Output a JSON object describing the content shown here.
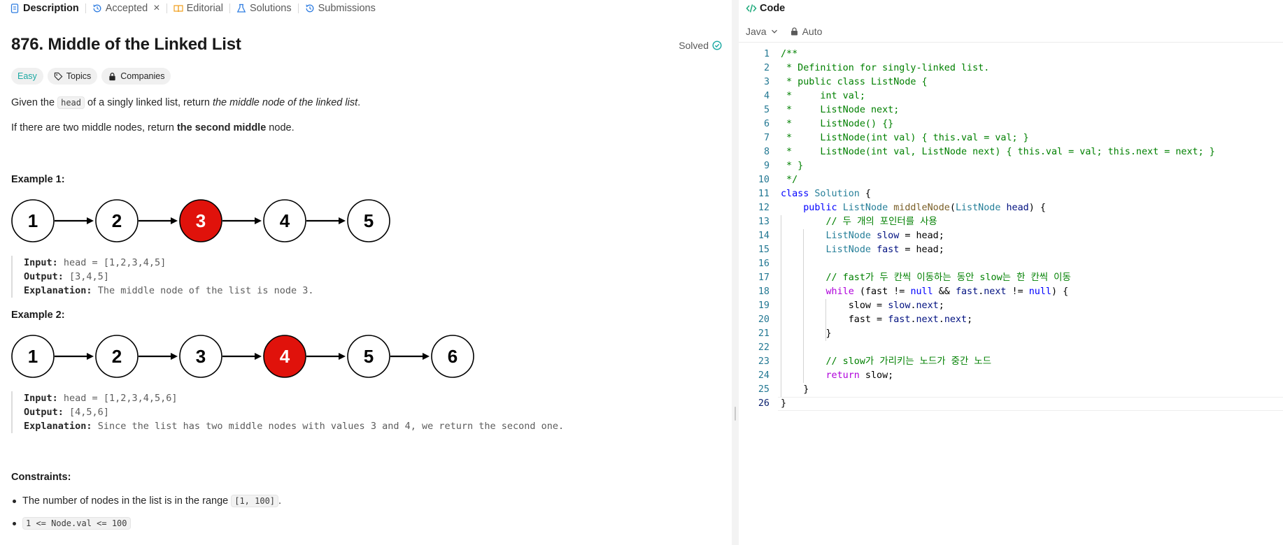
{
  "tabs": [
    {
      "label": "Description",
      "icon": "document-icon",
      "active": true
    },
    {
      "label": "Accepted",
      "icon": "history-icon",
      "active": false,
      "closable": true
    },
    {
      "label": "Editorial",
      "icon": "book-icon",
      "active": false
    },
    {
      "label": "Solutions",
      "icon": "flask-icon",
      "active": false
    },
    {
      "label": "Submissions",
      "icon": "history-icon",
      "active": false
    }
  ],
  "problem": {
    "title": "876. Middle of the Linked List",
    "status": "Solved",
    "tags": [
      {
        "label": "Easy",
        "kind": "difficulty",
        "color": "#1ca9a3"
      },
      {
        "label": "Topics",
        "icon": "tag-icon"
      },
      {
        "label": "Companies",
        "icon": "lock-icon"
      }
    ],
    "desc1": {
      "before": "Given the ",
      "code": "head",
      "middle": " of a singly linked list, return ",
      "italic": "the middle node of the linked list",
      "after": "."
    },
    "desc2": {
      "before": "If there are two middle nodes, return ",
      "bold": "the second middle",
      "after": " node."
    },
    "examples": [
      {
        "heading": "Example 1:",
        "nodes": [
          "1",
          "2",
          "3",
          "4",
          "5"
        ],
        "highlight_index": 2,
        "input_label": "Input:",
        "input": "head = [1,2,3,4,5]",
        "output_label": "Output:",
        "output": "[3,4,5]",
        "explanation_label": "Explanation:",
        "explanation": "The middle node of the list is node 3."
      },
      {
        "heading": "Example 2:",
        "nodes": [
          "1",
          "2",
          "3",
          "4",
          "5",
          "6"
        ],
        "highlight_index": 3,
        "input_label": "Input:",
        "input": "head = [1,2,3,4,5,6]",
        "output_label": "Output:",
        "output": "[4,5,6]",
        "explanation_label": "Explanation:",
        "explanation": "Since the list has two middle nodes with values 3 and 4, we return the second one."
      }
    ],
    "constraints_heading": "Constraints:",
    "constraints": [
      {
        "text": "The number of nodes in the list is in the range ",
        "code": "[1, 100]",
        "after": "."
      },
      {
        "text": "",
        "code": "1 <= Node.val <= 100",
        "after": ""
      }
    ],
    "highlight_color": "#e0120b"
  },
  "code_panel": {
    "title": "Code",
    "language": "Java",
    "mode": "Auto",
    "current_line": 26,
    "lines": [
      [
        [
          "/**",
          "cm"
        ]
      ],
      [
        [
          " * Definition for singly-linked list.",
          "cm"
        ]
      ],
      [
        [
          " * public class ListNode {",
          "cm"
        ]
      ],
      [
        [
          " *     int val;",
          "cm"
        ]
      ],
      [
        [
          " *     ListNode next;",
          "cm"
        ]
      ],
      [
        [
          " *     ListNode() {}",
          "cm"
        ]
      ],
      [
        [
          " *     ListNode(int val) { this.val = val; }",
          "cm"
        ]
      ],
      [
        [
          " *     ListNode(int val, ListNode next) { this.val = val; this.next = next; }",
          "cm"
        ]
      ],
      [
        [
          " * }",
          "cm"
        ]
      ],
      [
        [
          " */",
          "cm"
        ]
      ],
      [
        [
          "class",
          "kw"
        ],
        [
          " ",
          "tx"
        ],
        [
          "Solution",
          "ty"
        ],
        [
          " {",
          "tx"
        ]
      ],
      [
        [
          "    ",
          "tx"
        ],
        [
          "public",
          "kw"
        ],
        [
          " ",
          "tx"
        ],
        [
          "ListNode",
          "ty"
        ],
        [
          " ",
          "tx"
        ],
        [
          "middleNode",
          "fn"
        ],
        [
          "(",
          "tx"
        ],
        [
          "ListNode",
          "ty"
        ],
        [
          " ",
          "tx"
        ],
        [
          "head",
          "vr"
        ],
        [
          ") {",
          "tx"
        ]
      ],
      [
        [
          "        ",
          "tx"
        ],
        [
          "// 두 개의 포인터를 사용",
          "cm"
        ]
      ],
      [
        [
          "        ",
          "tx"
        ],
        [
          "ListNode",
          "ty"
        ],
        [
          " ",
          "tx"
        ],
        [
          "slow",
          "vr"
        ],
        [
          " = head;",
          "tx"
        ]
      ],
      [
        [
          "        ",
          "tx"
        ],
        [
          "ListNode",
          "ty"
        ],
        [
          " ",
          "tx"
        ],
        [
          "fast",
          "vr"
        ],
        [
          " = head;",
          "tx"
        ]
      ],
      [
        [
          "",
          "tx"
        ]
      ],
      [
        [
          "        ",
          "tx"
        ],
        [
          "// fast가 두 칸씩 이동하는 동안 slow는 한 칸씩 이동",
          "cm"
        ]
      ],
      [
        [
          "        ",
          "tx"
        ],
        [
          "while",
          "kc"
        ],
        [
          " (fast != ",
          "tx"
        ],
        [
          "null",
          "kw"
        ],
        [
          " && ",
          "tx"
        ],
        [
          "fast",
          "vr"
        ],
        [
          ".",
          "tx"
        ],
        [
          "next",
          "vr"
        ],
        [
          " != ",
          "tx"
        ],
        [
          "null",
          "kw"
        ],
        [
          ") {",
          "tx"
        ]
      ],
      [
        [
          "            slow = ",
          "tx"
        ],
        [
          "slow",
          "vr"
        ],
        [
          ".",
          "tx"
        ],
        [
          "next",
          "vr"
        ],
        [
          ";",
          "tx"
        ]
      ],
      [
        [
          "            fast = ",
          "tx"
        ],
        [
          "fast",
          "vr"
        ],
        [
          ".",
          "tx"
        ],
        [
          "next",
          "vr"
        ],
        [
          ".",
          "tx"
        ],
        [
          "next",
          "vr"
        ],
        [
          ";",
          "tx"
        ]
      ],
      [
        [
          "        }",
          "tx"
        ]
      ],
      [
        [
          "",
          "tx"
        ]
      ],
      [
        [
          "        ",
          "tx"
        ],
        [
          "// slow가 가리키는 노드가 중간 노드",
          "cm"
        ]
      ],
      [
        [
          "        ",
          "tx"
        ],
        [
          "return",
          "kc"
        ],
        [
          " slow;",
          "tx"
        ]
      ],
      [
        [
          "    }",
          "tx"
        ]
      ],
      [
        [
          "}",
          "tx"
        ]
      ]
    ]
  }
}
